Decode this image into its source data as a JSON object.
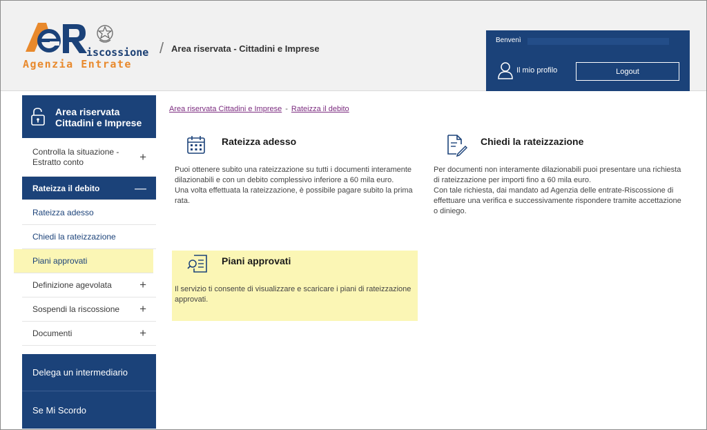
{
  "header": {
    "logo_top": "iscossione",
    "logo_bottom": "Agenzia Entrate",
    "title": "Area riservata - Cittadini e Imprese"
  },
  "user_box": {
    "welcome": "Benvenì",
    "profile_label": "Il mio profilo",
    "logout_label": "Logout"
  },
  "sidebar": {
    "heading_line1": "Area riservata",
    "heading_line2": "Cittadini e Imprese",
    "items": [
      {
        "label_line1": "Controlla la situazione -",
        "label_line2": "Estratto conto",
        "toggle": "+"
      },
      {
        "label": "Rateizza il debito",
        "toggle": "—"
      },
      {
        "label": "Rateizza adesso"
      },
      {
        "label": "Chiedi la rateizzazione"
      },
      {
        "label": "Piani approvati"
      },
      {
        "label": "Definizione agevolata",
        "toggle": "+"
      },
      {
        "label": "Sospendi la riscossione",
        "toggle": "+"
      },
      {
        "label": "Documenti",
        "toggle": "+"
      }
    ],
    "block_1": "Delega un intermediario",
    "block_2": "Se Mi Scordo"
  },
  "breadcrumb": {
    "item1": "Area riservata Cittadini e Imprese",
    "separator": "-",
    "item2": "Rateizza il debito"
  },
  "cards": {
    "rateizza_adesso": {
      "title": "Rateizza adesso",
      "text1": "Puoi ottenere subito una rateizzazione su tutti i documenti interamente dilazionabili e con un debito complessivo inferiore a 60 mila euro.",
      "text2": "Una volta effettuata la rateizzazione, è possibile pagare subito la prima rata.",
      "icon": "calendar-icon"
    },
    "chiedi": {
      "title": "Chiedi la rateizzazione",
      "text1": "Per documenti non interamente dilazionabili puoi presentare una richiesta di rateizzazione per importi fino a 60 mila euro.",
      "text2": "Con tale richiesta, dai mandato ad Agenzia delle entrate-Riscossione di effettuare una verifica e successivamente rispondere tramite accettazione o diniego.",
      "icon": "document-edit-icon"
    },
    "piani": {
      "title": "Piani approvati",
      "text1": "Il servizio ti consente di visualizzare e scaricare i piani di rateizzazione approvati.",
      "icon": "document-search-icon"
    }
  },
  "colors": {
    "brand_blue": "#1b4279",
    "highlight_yellow": "#fbf6b5",
    "link_purple": "#7b2b7f",
    "logo_orange": "#e8892c"
  }
}
